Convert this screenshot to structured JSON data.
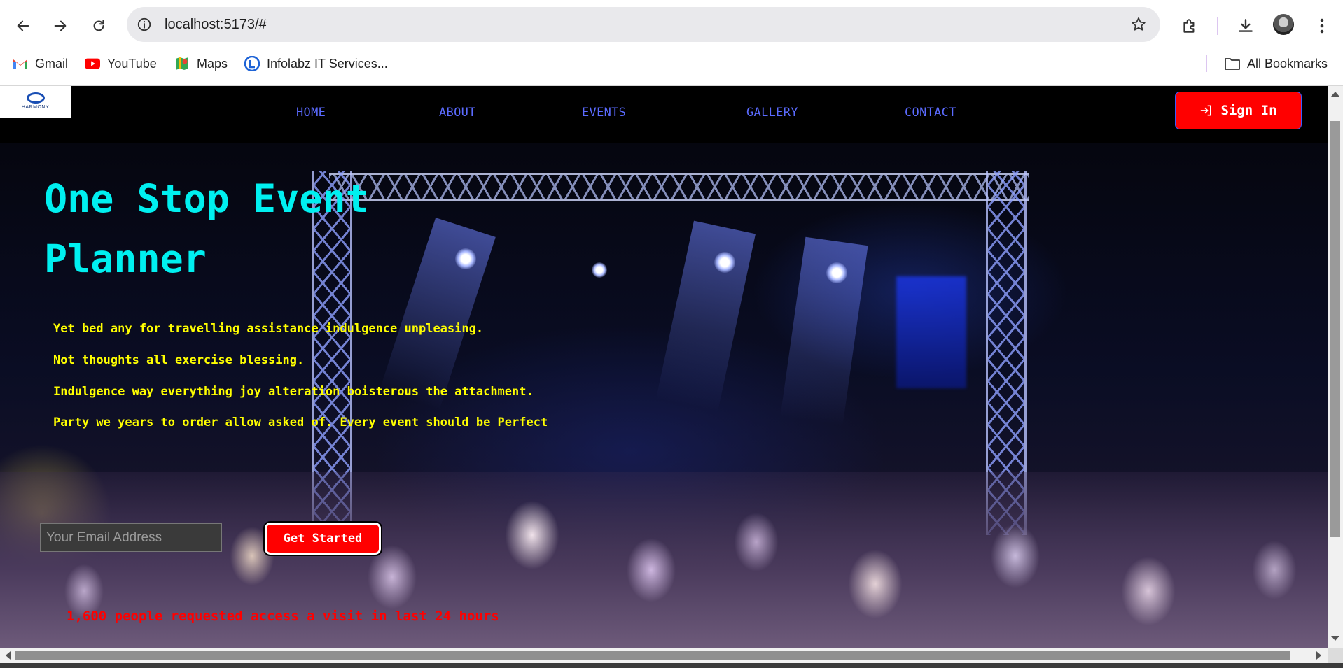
{
  "browser": {
    "url": "localhost:5173/#",
    "bookmarks": [
      {
        "label": "Gmail",
        "icon": "gmail-icon"
      },
      {
        "label": "YouTube",
        "icon": "youtube-icon"
      },
      {
        "label": "Maps",
        "icon": "maps-icon"
      },
      {
        "label": "Infolabz IT Services...",
        "icon": "infolabz-icon"
      }
    ],
    "all_bookmarks": "All Bookmarks"
  },
  "site": {
    "logo_text": "HARMONY",
    "nav": [
      "HOME",
      "ABOUT",
      "EVENTS",
      "GALLERY",
      "CONTACT"
    ],
    "signin_label": "Sign In"
  },
  "hero": {
    "title_line1": "One Stop Event",
    "title_line2": "Planner",
    "lines": [
      "Yet bed any for travelling assistance indulgence unpleasing.",
      "Not thoughts all exercise blessing.",
      "Indulgence way everything joy alteration boisterous the attachment.",
      "Party we years to order allow asked of. Every event should be Perfect"
    ],
    "email_placeholder": "Your Email Address",
    "cta_label": "Get Started",
    "note": "1,600 people requested access a visit in last 24 hours"
  },
  "colors": {
    "title": "#00f0f0",
    "body_text": "#ffff00",
    "nav_link": "#5b6bff",
    "accent_red": "#ff0000"
  }
}
